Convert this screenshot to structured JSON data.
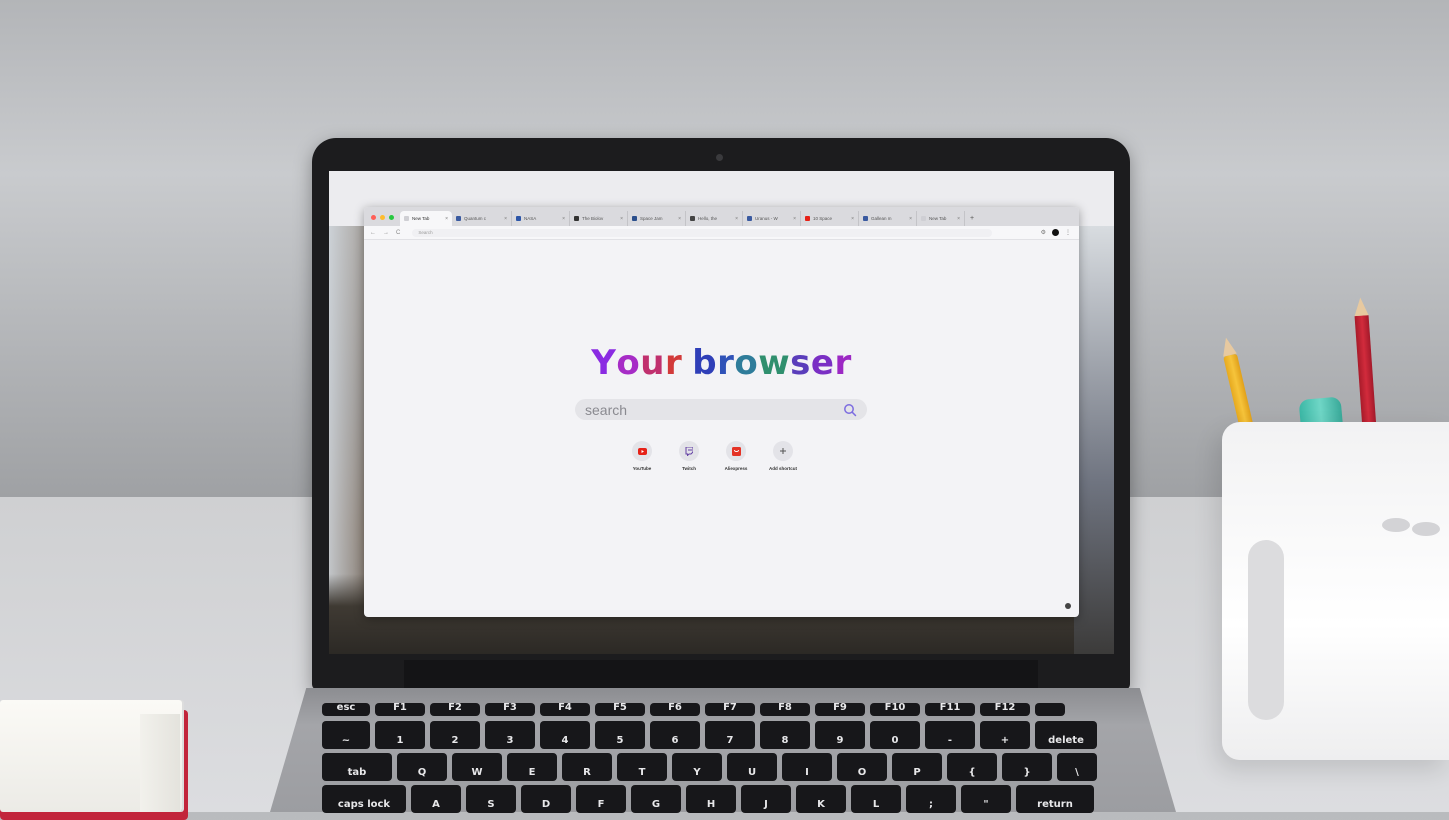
{
  "browser": {
    "tabs": [
      {
        "label": "New Tab",
        "favicon_color": "#cfcfd4",
        "active": true
      },
      {
        "label": "Quantum c",
        "favicon_color": "#3a5aa0"
      },
      {
        "label": "NASA",
        "favicon_color": "#2d56a8"
      },
      {
        "label": "The Biolov",
        "favicon_color": "#333333"
      },
      {
        "label": "Space Jam",
        "favicon_color": "#2b4f8c"
      },
      {
        "label": "Hello, the",
        "favicon_color": "#444444"
      },
      {
        "label": "Uranus - W",
        "favicon_color": "#3a5aa0"
      },
      {
        "label": "10 Space",
        "favicon_color": "#e62117"
      },
      {
        "label": "Gallean m",
        "favicon_color": "#3a5aa0"
      },
      {
        "label": "New Tab",
        "favicon_color": "#cfcfd4"
      }
    ],
    "new_tab_symbol": "+",
    "address_placeholder": "Search",
    "nav": {
      "back": "←",
      "forward": "→",
      "reload": "C"
    },
    "toolbar_icons": {
      "extensions": "⚙",
      "menu": "⋮"
    }
  },
  "page": {
    "hero_letters": [
      {
        "ch": "Y",
        "color": "#8a2be2"
      },
      {
        "ch": "o",
        "color": "#a62cc6"
      },
      {
        "ch": "u",
        "color": "#c0306e"
      },
      {
        "ch": "r",
        "color": "#d23a3a"
      },
      {
        "ch": " ",
        "color": "#000000"
      },
      {
        "ch": "b",
        "color": "#2f3fb8"
      },
      {
        "ch": "r",
        "color": "#2f52b8"
      },
      {
        "ch": "o",
        "color": "#2e7c9a"
      },
      {
        "ch": "w",
        "color": "#2f8f6e"
      },
      {
        "ch": "s",
        "color": "#5a3dbb"
      },
      {
        "ch": "e",
        "color": "#7a2fc4"
      },
      {
        "ch": "r",
        "color": "#9c28c4"
      }
    ],
    "search_placeholder": "search",
    "shortcuts": [
      {
        "label": "YouTube",
        "icon": "youtube-icon",
        "color": "#e62117"
      },
      {
        "label": "Twitch",
        "icon": "twitch-icon",
        "color": "#6441a5"
      },
      {
        "label": "Aliexpress",
        "icon": "aliexpress-icon",
        "color": "#e43225"
      },
      {
        "label": "Add shortcut",
        "icon": "plus-icon",
        "color": "#555555"
      }
    ]
  },
  "keyboard": {
    "fn_row": [
      "esc",
      "F1",
      "F2",
      "F3",
      "F4",
      "F5",
      "F6",
      "F7",
      "F8",
      "F9",
      "F10",
      "F11",
      "F12",
      ""
    ],
    "num_row": [
      "~",
      "1",
      "2",
      "3",
      "4",
      "5",
      "6",
      "7",
      "8",
      "9",
      "0",
      "-",
      "+",
      "delete"
    ],
    "q_row": [
      "tab",
      "Q",
      "W",
      "E",
      "R",
      "T",
      "Y",
      "U",
      "I",
      "O",
      "P",
      "{",
      "}",
      "\\"
    ],
    "a_row": [
      "caps lock",
      "A",
      "S",
      "D",
      "F",
      "G",
      "H",
      "J",
      "K",
      "L",
      ";",
      "\"",
      "return"
    ]
  }
}
